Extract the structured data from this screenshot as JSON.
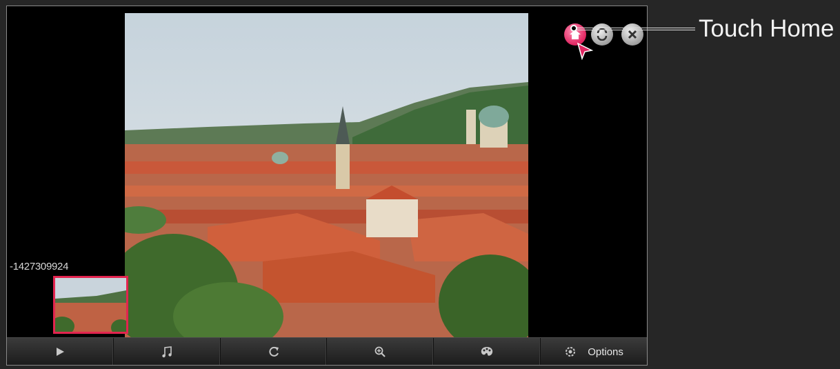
{
  "viewer": {
    "file_name": "-1427309924",
    "photo_icon": "prague-cityscape-photo"
  },
  "top_controls": [
    {
      "icon": "home-icon",
      "color": "#e02561"
    },
    {
      "icon": "sync-icon"
    },
    {
      "icon": "close-icon"
    }
  ],
  "callout": {
    "label": "Touch Home"
  },
  "toolbar": {
    "buttons": [
      {
        "icon": "play-icon"
      },
      {
        "icon": "music-note-icon"
      },
      {
        "icon": "rotate-icon"
      },
      {
        "icon": "zoom-in-icon"
      },
      {
        "icon": "palette-icon"
      },
      {
        "icon": "gear-icon",
        "label": "Options"
      }
    ]
  },
  "colors": {
    "accent": "#e3244f",
    "frame_background": "#000000",
    "page_background": "#262626"
  }
}
